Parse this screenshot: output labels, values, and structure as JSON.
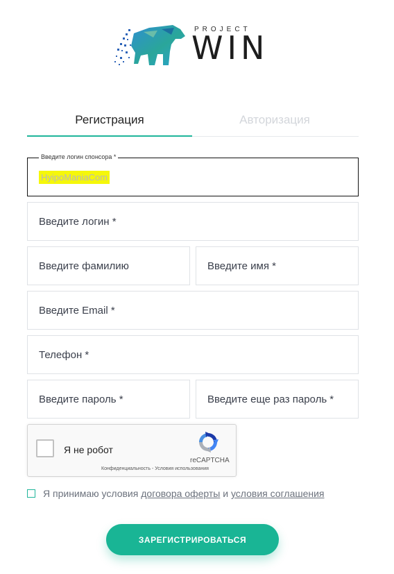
{
  "logo": {
    "project_text": "PROJECT",
    "win_text": "WIN",
    "icon": "bear-icon"
  },
  "tabs": [
    {
      "label": "Регистрация",
      "active": true
    },
    {
      "label": "Авторизация",
      "active": false
    }
  ],
  "form": {
    "sponsor": {
      "legend": "Введите логин спонсора *",
      "value": "HyipoManiaCom"
    },
    "login_placeholder": "Введите логин *",
    "surname_placeholder": "Введите фамилию",
    "name_placeholder": "Введите имя *",
    "email_placeholder": "Введите Email *",
    "phone_placeholder": "Телефон *",
    "password_placeholder": "Введите пароль *",
    "password_repeat_placeholder": "Введите еще раз пароль *"
  },
  "recaptcha": {
    "label": "Я не робот",
    "brand": "reCAPTCHA",
    "links": "Конфиденциальность - Условия использования"
  },
  "agreement": {
    "prefix": "Я принимаю условия ",
    "offer_link": "договора оферты",
    "middle": " и ",
    "terms_link": "условия соглашения"
  },
  "submit_label": "ЗАРЕГИСТРИРОВАТЬСЯ",
  "colors": {
    "accent": "#19b595",
    "highlight": "#f5f70a",
    "inactive_tab": "#d3d6db"
  }
}
